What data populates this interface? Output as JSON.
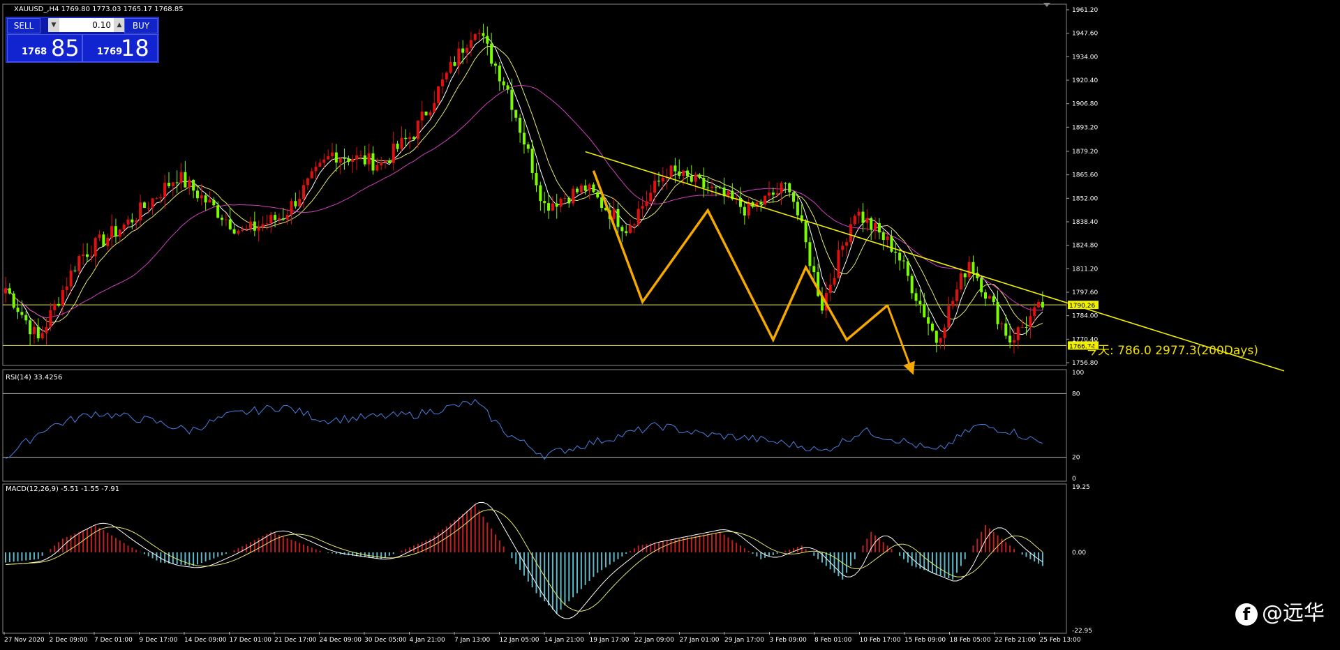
{
  "chart_title": "XAUUSD_,H4  1769.80 1773.03 1765.17 1768.85",
  "trade_panel": {
    "sell_label": "SELL",
    "buy_label": "BUY",
    "lot": "0.10",
    "sell_small": "1768",
    "sell_big": "85",
    "buy_small": "1769",
    "buy_big": "18"
  },
  "annotation": "今天: 786.0  2977.3(200Days)",
  "watermark": "@远华",
  "colors": {
    "bull": "#e01010",
    "bear": "#7cfc00",
    "trend": "#f0f000",
    "arrow": "#f5a800",
    "rsi": "#4a7fe0",
    "macd_pos": "#c02020",
    "macd_neg": "#5fb8c8"
  },
  "chart_data": [
    {
      "type": "line",
      "name": "price",
      "price_ticks": [
        "1961.20",
        "1947.60",
        "1934.00",
        "1920.40",
        "1906.80",
        "1893.20",
        "1879.20",
        "1865.60",
        "1852.00",
        "1838.40",
        "1824.80",
        "1811.20",
        "1797.60",
        "1784.00",
        "1770.40",
        "1756.80"
      ],
      "ylim": [
        1756.8,
        1961.2
      ],
      "levels": [
        {
          "label": "1790.26",
          "value": 1790.26
        },
        {
          "label": "1766.74",
          "value": 1766.74
        }
      ],
      "x_labels": [
        "27 Nov 2020",
        "2 Dec 09:00",
        "7 Dec 01:00",
        "9 Dec 17:00",
        "14 Dec 09:00",
        "17 Dec 01:00",
        "21 Dec 17:00",
        "24 Dec 09:00",
        "30 Dec 05:00",
        "4 Jan 21:00",
        "7 Jan 13:00",
        "12 Jan 05:00",
        "14 Jan 21:00",
        "19 Jan 17:00",
        "22 Jan 09:00",
        "27 Jan 01:00",
        "29 Jan 17:00",
        "3 Feb 09:00",
        "8 Feb 01:00",
        "10 Feb 17:00",
        "15 Feb 09:00",
        "18 Feb 05:00",
        "22 Feb 21:00",
        "25 Feb 13:00"
      ],
      "key_points": [
        [
          0,
          1800
        ],
        [
          8,
          1770
        ],
        [
          18,
          1818
        ],
        [
          30,
          1838
        ],
        [
          42,
          1865
        ],
        [
          58,
          1832
        ],
        [
          68,
          1842
        ],
        [
          80,
          1878
        ],
        [
          92,
          1872
        ],
        [
          100,
          1890
        ],
        [
          115,
          1952
        ],
        [
          123,
          1915
        ],
        [
          132,
          1848
        ],
        [
          142,
          1858
        ],
        [
          152,
          1835
        ],
        [
          162,
          1868
        ],
        [
          172,
          1858
        ],
        [
          182,
          1845
        ],
        [
          192,
          1860
        ],
        [
          200,
          1790
        ],
        [
          208,
          1845
        ],
        [
          218,
          1822
        ],
        [
          228,
          1770
        ],
        [
          236,
          1816
        ],
        [
          246,
          1770
        ],
        [
          254,
          1790
        ]
      ]
    },
    {
      "type": "line",
      "name": "RSI(14) 33.4256",
      "ticks": [
        "100",
        "80",
        "20",
        "0"
      ],
      "ylim": [
        0,
        100
      ],
      "key_points": [
        [
          0,
          20
        ],
        [
          10,
          48
        ],
        [
          22,
          62
        ],
        [
          35,
          55
        ],
        [
          45,
          45
        ],
        [
          55,
          60
        ],
        [
          68,
          68
        ],
        [
          78,
          55
        ],
        [
          90,
          58
        ],
        [
          100,
          60
        ],
        [
          115,
          72
        ],
        [
          123,
          42
        ],
        [
          132,
          22
        ],
        [
          145,
          35
        ],
        [
          160,
          50
        ],
        [
          170,
          42
        ],
        [
          182,
          38
        ],
        [
          196,
          30
        ],
        [
          200,
          25
        ],
        [
          210,
          45
        ],
        [
          220,
          35
        ],
        [
          228,
          25
        ],
        [
          238,
          50
        ],
        [
          246,
          45
        ],
        [
          254,
          33
        ]
      ]
    },
    {
      "type": "bar",
      "name": "MACD(12,26,9) -5.51 -1.55 -7.91",
      "ticks": [
        "19.25",
        "0.00",
        "-22.95"
      ],
      "ylim": [
        -22.95,
        19.25
      ],
      "key_points": [
        [
          0,
          -3
        ],
        [
          8,
          -2
        ],
        [
          14,
          4
        ],
        [
          22,
          8
        ],
        [
          30,
          2
        ],
        [
          38,
          -3
        ],
        [
          46,
          -4
        ],
        [
          55,
          0
        ],
        [
          65,
          6
        ],
        [
          78,
          0
        ],
        [
          92,
          -2
        ],
        [
          104,
          4
        ],
        [
          115,
          14
        ],
        [
          123,
          0
        ],
        [
          130,
          -12
        ],
        [
          135,
          -18
        ],
        [
          145,
          -6
        ],
        [
          155,
          2
        ],
        [
          165,
          4
        ],
        [
          175,
          6
        ],
        [
          185,
          -2
        ],
        [
          195,
          2
        ],
        [
          205,
          -8
        ],
        [
          212,
          6
        ],
        [
          222,
          -4
        ],
        [
          232,
          -8
        ],
        [
          240,
          8
        ],
        [
          248,
          0
        ],
        [
          254,
          -4
        ]
      ]
    }
  ]
}
